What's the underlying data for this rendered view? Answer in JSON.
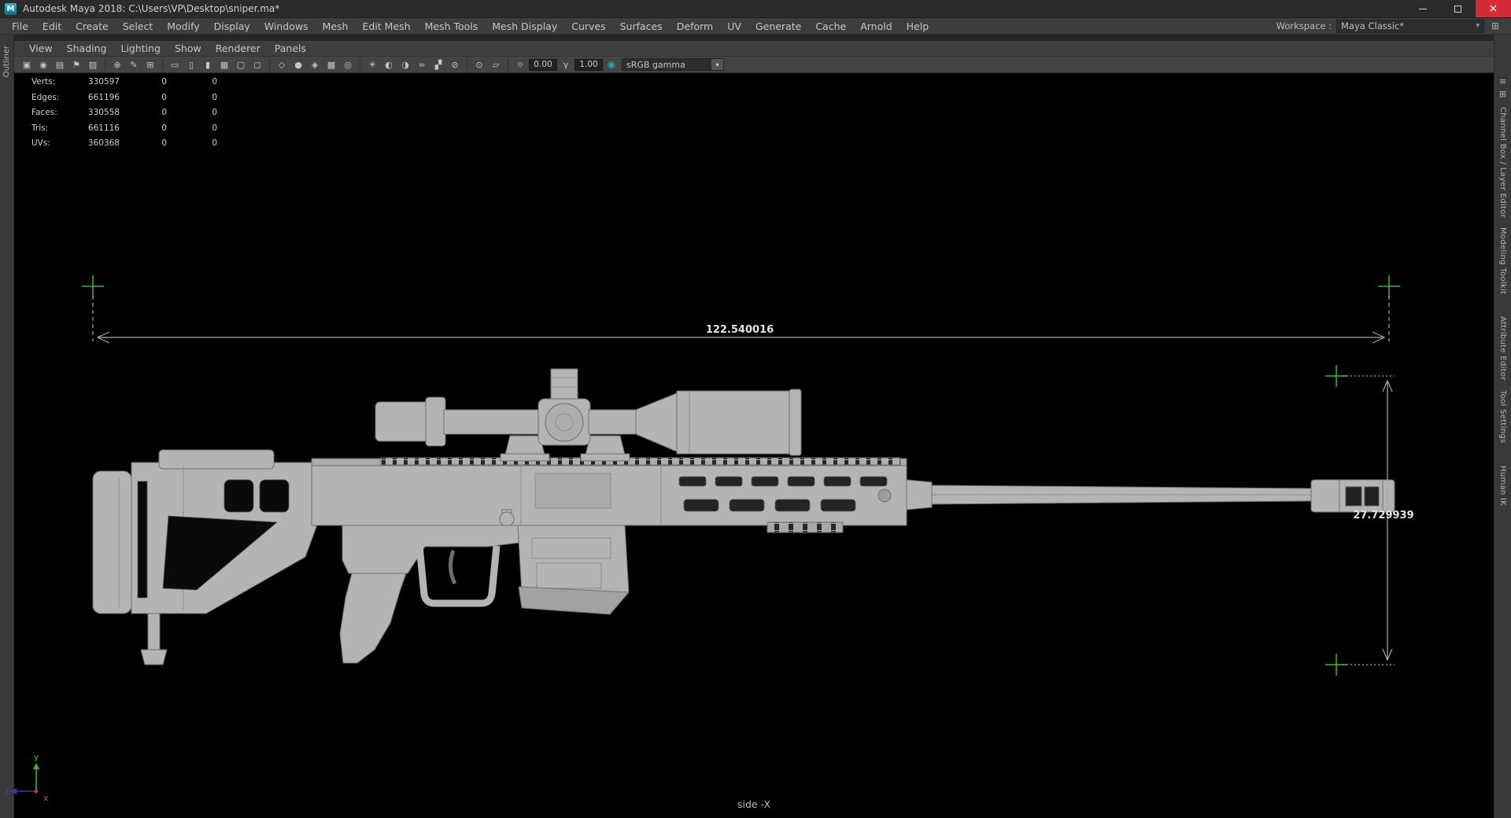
{
  "titlebar": {
    "app_icon_letter": "M",
    "title": "Autodesk Maya 2018: C:\\Users\\VP\\Desktop\\sniper.ma*",
    "close_glyph": "×"
  },
  "menubar": {
    "items": [
      "File",
      "Edit",
      "Create",
      "Select",
      "Modify",
      "Display",
      "Windows",
      "Mesh",
      "Edit Mesh",
      "Mesh Tools",
      "Mesh Display",
      "Curves",
      "Surfaces",
      "Deform",
      "UV",
      "Generate",
      "Cache",
      "Arnold",
      "Help"
    ],
    "workspace_label": "Workspace :",
    "workspace_value": "Maya Classic*"
  },
  "panel_menubar": {
    "items": [
      "View",
      "Shading",
      "Lighting",
      "Show",
      "Renderer",
      "Panels"
    ]
  },
  "panel_toolbar": {
    "icons": [
      {
        "name": "select-camera",
        "glyph": "▣"
      },
      {
        "name": "lock-camera",
        "glyph": "◉"
      },
      {
        "name": "camera-attributes",
        "glyph": "▤"
      },
      {
        "name": "bookmarks",
        "glyph": "⚑"
      },
      {
        "name": "image-plane",
        "glyph": "▧"
      },
      {
        "name": "2d-pan-zoom",
        "glyph": "⊕"
      },
      {
        "name": "grease-pencil",
        "glyph": "✎"
      },
      {
        "name": "grid",
        "glyph": "⊞"
      },
      {
        "name": "film-gate",
        "glyph": "▭"
      },
      {
        "name": "resolution-gate",
        "glyph": "▯"
      },
      {
        "name": "gate-mask",
        "glyph": "▮"
      },
      {
        "name": "field-chart",
        "glyph": "▦"
      },
      {
        "name": "safe-action",
        "glyph": "▢"
      },
      {
        "name": "safe-title",
        "glyph": "◻"
      },
      {
        "name": "wireframe",
        "glyph": "◇"
      },
      {
        "name": "smooth-shade",
        "glyph": "●"
      },
      {
        "name": "wireframe-on-shaded",
        "glyph": "◈"
      },
      {
        "name": "textured",
        "glyph": "▩"
      },
      {
        "name": "use-default-material",
        "glyph": "◎"
      },
      {
        "name": "all-lights",
        "glyph": "☀"
      },
      {
        "name": "shadows",
        "glyph": "◐"
      },
      {
        "name": "screen-space-ao",
        "glyph": "◑"
      },
      {
        "name": "motion-blur",
        "glyph": "≈"
      },
      {
        "name": "multisample",
        "glyph": "▞"
      },
      {
        "name": "depth-of-field",
        "glyph": "⊘"
      },
      {
        "name": "isolate-select",
        "glyph": "⊙"
      },
      {
        "name": "xray",
        "glyph": "▱"
      },
      {
        "name": "exposure-toggle",
        "glyph": "☼"
      }
    ],
    "exposure_value": "0.00",
    "gamma_icon_glyph": "γ",
    "gamma_value": "1.00",
    "cm_icon_glyph": "◉",
    "view_transform": "sRGB gamma"
  },
  "hud": {
    "rows": [
      {
        "label": "Verts:",
        "total": "330597",
        "sel": "0",
        "other": "0"
      },
      {
        "label": "Edges:",
        "total": "661196",
        "sel": "0",
        "other": "0"
      },
      {
        "label": "Faces:",
        "total": "330558",
        "sel": "0",
        "other": "0"
      },
      {
        "label": "Tris:",
        "total": "661116",
        "sel": "0",
        "other": "0"
      },
      {
        "label": "UVs:",
        "total": "360368",
        "sel": "0",
        "other": "0"
      }
    ]
  },
  "viewport": {
    "view_label": "side -X",
    "measurements": {
      "horizontal": "122.540016",
      "vertical": "27.729939"
    },
    "axis": {
      "x": "x",
      "y": "y",
      "z": "z"
    }
  },
  "sidebars": {
    "left_tab": "Outliner",
    "right_tabs": [
      "Channel Box / Layer Editor",
      "Modeling Toolkit",
      "Attribute Editor",
      "Tool Settings",
      "Human IK"
    ]
  },
  "glyphs": {
    "combo_arrow": "▾",
    "list_icon": "≡",
    "grid_icon": "⊞",
    "workspace_settings_icon": "⊞"
  },
  "colors": {
    "viewport_bg": "#000000",
    "ui_bg": "#3d3d3d",
    "rifle_gray": "#b4b4b4",
    "locator_green": "#3db53d",
    "dimension_line": "#a8a8a8",
    "axis_y_green": "#35b535",
    "close_red": "#d32b39"
  }
}
